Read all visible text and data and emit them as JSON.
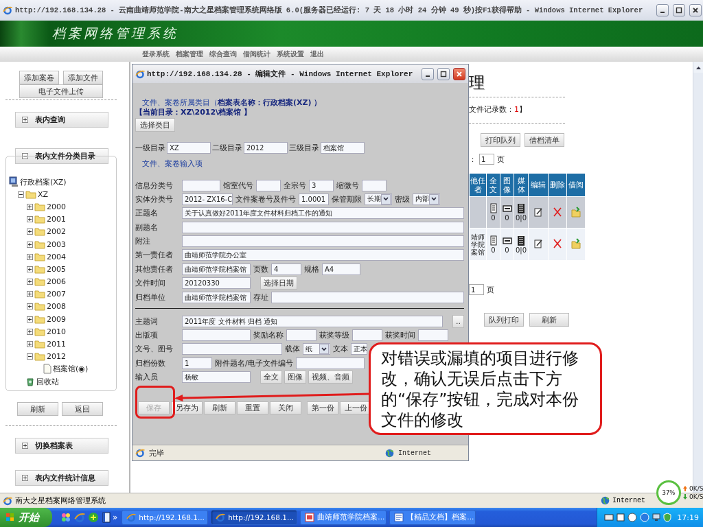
{
  "browser": {
    "title": "http://192.168.134.28 - 云南曲靖师范学院-南大之星档案管理系统网络版 6.0(服务器已经运行: 7 天 18 小时 24 分钟 49 秒)按F1获得帮助 - Windows Internet Explorer",
    "status": "南大之星档案网络管理系统",
    "zone": "Internet"
  },
  "banner": {
    "title": "档案网络管理系统"
  },
  "nav": [
    "登录系统",
    "档案管理",
    "综合查询",
    "借阅统计",
    "系统设置",
    "退出"
  ],
  "sidebar": {
    "top_buttons": [
      "添加案卷",
      "添加文件",
      "电子文件上传"
    ],
    "panels": [
      {
        "label": "表内查询",
        "expanded": false
      },
      {
        "label": "表内文件分类目录",
        "expanded": true
      }
    ],
    "tree": {
      "kind": "computer",
      "label": "行政档案(XZ)",
      "children": [
        {
          "kind": "folder",
          "label": "XZ",
          "expanded": true,
          "children": [
            {
              "kind": "folder",
              "label": "2000",
              "expanded": false
            },
            {
              "kind": "folder",
              "label": "2001",
              "expanded": false
            },
            {
              "kind": "folder",
              "label": "2002",
              "expanded": false
            },
            {
              "kind": "folder",
              "label": "2003",
              "expanded": false
            },
            {
              "kind": "folder",
              "label": "2004",
              "expanded": false
            },
            {
              "kind": "folder",
              "label": "2005",
              "expanded": false
            },
            {
              "kind": "folder",
              "label": "2006",
              "expanded": false
            },
            {
              "kind": "folder",
              "label": "2007",
              "expanded": false
            },
            {
              "kind": "folder",
              "label": "2008",
              "expanded": false
            },
            {
              "kind": "folder",
              "label": "2009",
              "expanded": false
            },
            {
              "kind": "folder",
              "label": "2010",
              "expanded": false
            },
            {
              "kind": "folder",
              "label": "2011",
              "expanded": false
            },
            {
              "kind": "folder",
              "label": "2012",
              "expanded": true,
              "children": [
                {
                  "kind": "file",
                  "label": "档案馆(◉)"
                }
              ]
            }
          ]
        },
        {
          "kind": "recycle",
          "label": "回收站"
        }
      ]
    },
    "tree_buttons": [
      "刷新",
      "返回"
    ],
    "bottom_panels": [
      {
        "label": "切换档案表",
        "expanded": false
      },
      {
        "label": "表内文件统计信息",
        "expanded": false
      }
    ]
  },
  "main": {
    "heading": "理",
    "record_label": "文件记录数：",
    "record_count": "1",
    "record_end": "】",
    "buttons": [
      "打印队列",
      "借档清单"
    ],
    "page_prefix": "：",
    "page_value": "1",
    "page_suffix": "页",
    "table": {
      "columns": [
        "他任者",
        "全文",
        "图像",
        "媒体",
        "编辑",
        "删除",
        "借阅"
      ],
      "rows": [
        {
          "selected": true,
          "full_text": "0",
          "image": "0",
          "media": "0|0"
        },
        {
          "selected": false,
          "responsible": "靖师学院案馆",
          "full_text": "0",
          "image": "0",
          "media": "0|0"
        }
      ]
    },
    "page_value_2": "1",
    "page_suffix_2": "页",
    "bottom_buttons": [
      "队列打印",
      "刷新"
    ]
  },
  "popup": {
    "title": "http://192.168.134.28 - 编辑文件 - Windows Internet Explorer",
    "category": "文件、案卷所属类目（**档案表名称：行政档案(XZ) ）**",
    "current_dir": "【当前目录：XZ\\2012\\档案馆 】",
    "select_button": "选择类目",
    "levels": [
      {
        "label": "一级目录",
        "value": "XZ"
      },
      {
        "label": "二级目录",
        "value": "2012"
      },
      {
        "label": "三级目录",
        "value": "档案馆"
      }
    ],
    "section": "文件、案卷输入项",
    "rows": [
      {
        "items": [
          {
            "kind": "label",
            "text": "信息分类号"
          },
          {
            "kind": "field"
          },
          {
            "kind": "label",
            "text": "馆室代号"
          },
          {
            "kind": "tiny-field"
          },
          {
            "kind": "label",
            "text": "全宗号"
          },
          {
            "kind": "tiny-field",
            "value": "3"
          },
          {
            "kind": "label",
            "text": "缩微号"
          },
          {
            "kind": "tiny-field"
          }
        ]
      },
      {
        "items": [
          {
            "kind": "label",
            "text": "实体分类号"
          },
          {
            "kind": "medium-field",
            "value": "2012- ZX16-C"
          },
          {
            "kind": "label",
            "text": "文件案卷号及件号"
          },
          {
            "kind": "short-field",
            "value": "1.0001"
          },
          {
            "kind": "label",
            "text": "保管期限"
          },
          {
            "kind": "select",
            "value": "长期"
          },
          {
            "kind": "label",
            "text": "密级"
          },
          {
            "kind": "select",
            "value": "内部"
          }
        ]
      },
      {
        "items": [
          {
            "kind": "label",
            "text": "正题名"
          },
          {
            "kind": "long-field",
            "value": "关于认真做好2011年度文件材料归档工作的通知"
          }
        ]
      },
      {
        "items": [
          {
            "kind": "label",
            "text": "副题名"
          },
          {
            "kind": "long-field"
          }
        ]
      },
      {
        "items": [
          {
            "kind": "label",
            "text": "附注"
          },
          {
            "kind": "long-field"
          }
        ]
      },
      {
        "items": [
          {
            "kind": "label",
            "text": "第一责任者"
          },
          {
            "kind": "long-field",
            "value": "曲靖师范学院办公室"
          }
        ]
      },
      {
        "items": [
          {
            "kind": "label",
            "text": "其他责任者"
          },
          {
            "kind": "wide-field",
            "value": "曲靖师范学院档案馆"
          },
          {
            "kind": "label",
            "text": "页数"
          },
          {
            "kind": "short-field",
            "value": "4"
          },
          {
            "kind": "label",
            "text": "规格"
          },
          {
            "kind": "field",
            "value": "A4"
          }
        ]
      },
      {
        "items": [
          {
            "kind": "label",
            "text": "文件时间"
          },
          {
            "kind": "wide-field",
            "value": "20120330"
          },
          {
            "kind": "button",
            "text": "选择日期"
          }
        ]
      },
      {
        "items": [
          {
            "kind": "label",
            "text": "归档单位"
          },
          {
            "kind": "wide-field",
            "value": "曲靖师范学院档案馆"
          },
          {
            "kind": "label",
            "text": "存址"
          },
          {
            "kind": "long-field"
          }
        ]
      }
    ],
    "rows_2": [
      {
        "items": [
          {
            "kind": "label",
            "text": "主题词"
          },
          {
            "kind": "long-field",
            "value": "2011年度  文件材料  归档  通知"
          },
          {
            "kind": "button",
            "text": ".."
          }
        ]
      },
      {
        "items": [
          {
            "kind": "label",
            "text": "出版项"
          },
          {
            "kind": "wide-field"
          },
          {
            "kind": "label",
            "text": "奖励名称"
          },
          {
            "kind": "short-field"
          },
          {
            "kind": "label",
            "text": "获奖等级"
          },
          {
            "kind": "short-field"
          },
          {
            "kind": "label",
            "text": "获奖时间"
          },
          {
            "kind": "short-field"
          }
        ]
      },
      {
        "items": [
          {
            "kind": "label",
            "text": "文号、图号"
          },
          {
            "kind": "extra-wide-field"
          },
          {
            "kind": "label",
            "text": "载体"
          },
          {
            "kind": "select",
            "value": "纸"
          },
          {
            "kind": "label",
            "text": "文本"
          },
          {
            "kind": "stub-field",
            "value": "正本"
          }
        ]
      },
      {
        "items": [
          {
            "kind": "label",
            "text": "归档份数"
          },
          {
            "kind": "short-field",
            "value": "1"
          },
          {
            "kind": "label",
            "text": "附件题名/电子文件编号"
          },
          {
            "kind": "wide-field"
          }
        ]
      },
      {
        "items": [
          {
            "kind": "label",
            "text": "输入员"
          },
          {
            "kind": "wide-field",
            "value": "杨敏"
          },
          {
            "kind": "button",
            "text": "全文"
          },
          {
            "kind": "button",
            "text": "图像"
          },
          {
            "kind": "button",
            "text": "视频、音频"
          }
        ]
      }
    ],
    "actions": [
      {
        "label": "保存",
        "disabled": true
      },
      {
        "label": "另存为",
        "disabled": false
      },
      {
        "label": "刷新",
        "disabled": false
      },
      {
        "label": "重置",
        "disabled": false
      },
      {
        "label": "关闭",
        "disabled": false
      }
    ],
    "records": [
      "第一份",
      "上一份"
    ],
    "status": "完毕",
    "zone": "Internet"
  },
  "callout": {
    "text": "对错误或漏填的项目进行修改，确认无误后点击下方的“保存”按钮，完成对本份文件的修改"
  },
  "taskbar": {
    "start": "开始",
    "more": "»",
    "tasks": [
      {
        "kind": "browser",
        "label": "http://192.168.1...",
        "selected": false
      },
      {
        "kind": "browser",
        "label": "http://192.168.1...",
        "selected": true
      },
      {
        "kind": "slides",
        "label": "曲靖师范学院档案...",
        "selected": false
      },
      {
        "kind": "document",
        "label": "【精品文档】档案...",
        "selected": false
      }
    ],
    "meter": "37%",
    "upload": "0K/S",
    "download": "0K/S",
    "clock": "17:19"
  }
}
